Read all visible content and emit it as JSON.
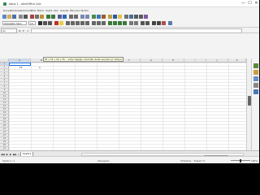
{
  "window": {
    "title": "Adsız 1 - LibreOffice Calc",
    "controls": {
      "minimize": "—",
      "maximize": "☐",
      "close": "✕"
    }
  },
  "menubar": {
    "items": [
      "Dosya",
      "Düzenle",
      "Görünüm",
      "Ekle",
      "Biçim",
      "Sayfa",
      "Veri",
      "Araçlar",
      "Pencere",
      "Yardım"
    ]
  },
  "toolbar": {
    "font_name": "Liberation Sans",
    "font_size": "10"
  },
  "formula_bar": {
    "name_box": "A1",
    "fx_label": "fx",
    "sum_label": "Σ",
    "equals_label": "="
  },
  "grid": {
    "columns": [
      "A",
      "B",
      "C",
      "D",
      "E",
      "F",
      "G",
      "H",
      "I",
      "J",
      "K"
    ],
    "rows": [
      "1",
      "2",
      "3",
      "4",
      "5",
      "6",
      "7",
      "8",
      "9",
      "10",
      "11",
      "12",
      "13",
      "14",
      "15",
      "16",
      "17",
      "18",
      "19",
      "20",
      "21",
      "22",
      "23",
      "24",
      "25",
      "26",
      "27"
    ],
    "cells": {
      "A2": "10",
      "C2": "A"
    }
  },
  "tooltip": {
    "text": "E4 + F4 + C6 + F6 … sütun başlığını otomatik olarak seçmek için tıklayın"
  },
  "sheet_tabs": {
    "nav": [
      "◀◀",
      "◀",
      "▶",
      "▶▶"
    ],
    "add": "+",
    "active": "Sayfa1"
  },
  "statusbar": {
    "left": "Sayfa 1 / 1",
    "middle": "Varsayılan",
    "right": "Ortalama: ; Toplam: 0",
    "zoom": "100%"
  },
  "colors": {
    "accent": "#1a73e8",
    "sidebar_icons": [
      "#5a8a3a",
      "#c8a040",
      "#6a8fc8",
      "#888888",
      "#4a7ab8"
    ]
  }
}
